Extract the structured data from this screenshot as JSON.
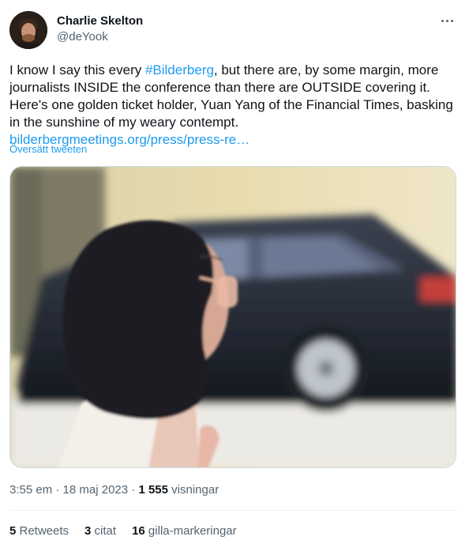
{
  "author": {
    "name": "Charlie Skelton",
    "handle": "@deYook"
  },
  "tweet": {
    "text_before_hashtag": "I know I say this every ",
    "hashtag": "#Bilderberg",
    "text_after_hashtag": ", but there are, by some margin, more journalists INSIDE the conference than there are OUTSIDE covering it. Here's one golden ticket holder, Yuan Yang of the Financial Times, basking in the sunshine of my weary contempt.",
    "link": "bilderbergmeetings.org/press/press-re…",
    "translate_label": "Översätt tweeten"
  },
  "meta": {
    "time": "3:55 em",
    "separator": " · ",
    "date": "18 maj 2023",
    "views_count": "1 555",
    "views_label": " visningar"
  },
  "stats": {
    "retweets_count": "5",
    "retweets_label": " Retweets",
    "quotes_count": "3",
    "quotes_label": " citat",
    "likes_count": "16",
    "likes_label": " gilla-markeringar"
  },
  "colors": {
    "link": "#1d9bf0",
    "secondary_text": "#536471",
    "primary_text": "#0f1419"
  },
  "icons": {
    "more": "more-horizontal-icon"
  }
}
